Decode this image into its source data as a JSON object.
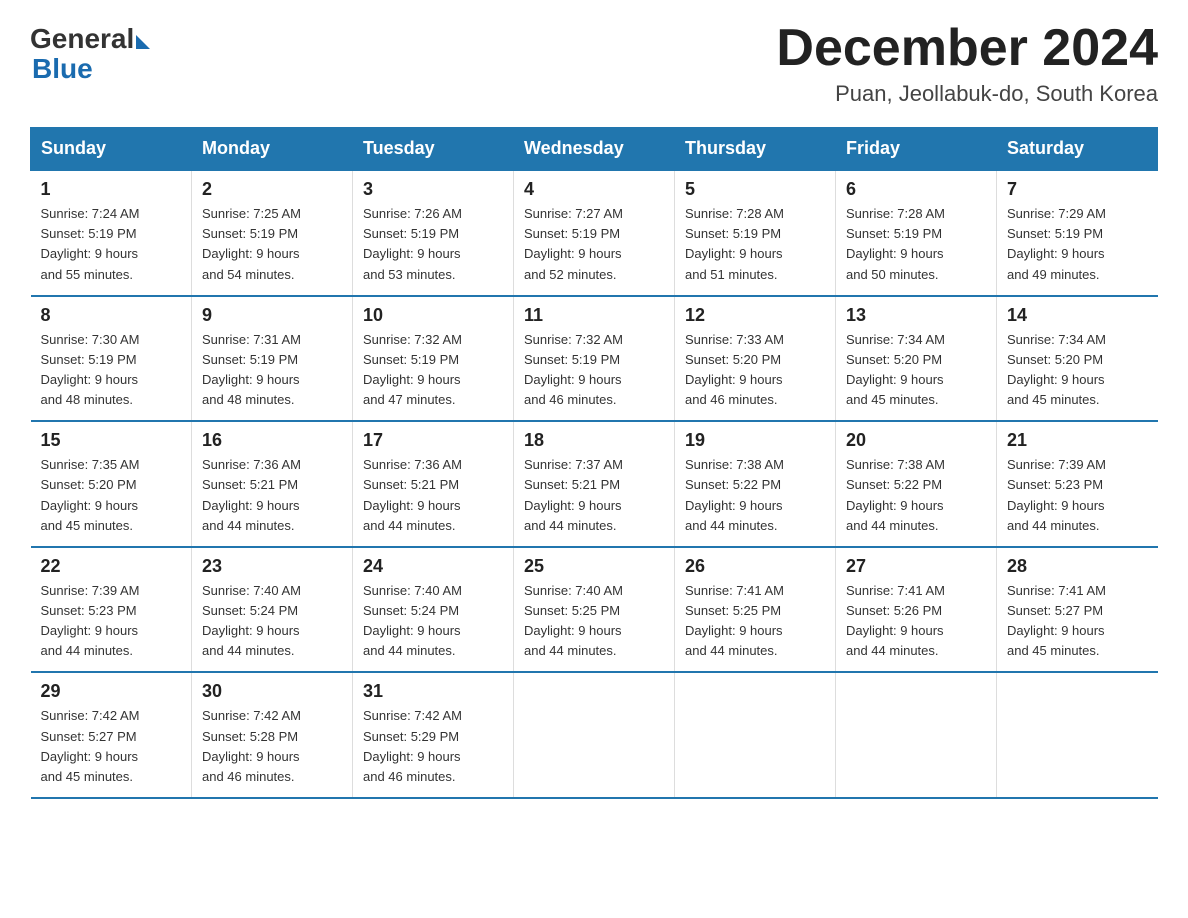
{
  "header": {
    "logo_general": "General",
    "logo_blue": "Blue",
    "month_title": "December 2024",
    "location": "Puan, Jeollabuk-do, South Korea"
  },
  "days_of_week": [
    "Sunday",
    "Monday",
    "Tuesday",
    "Wednesday",
    "Thursday",
    "Friday",
    "Saturday"
  ],
  "weeks": [
    [
      {
        "day": "1",
        "sunrise": "7:24 AM",
        "sunset": "5:19 PM",
        "daylight": "9 hours and 55 minutes."
      },
      {
        "day": "2",
        "sunrise": "7:25 AM",
        "sunset": "5:19 PM",
        "daylight": "9 hours and 54 minutes."
      },
      {
        "day": "3",
        "sunrise": "7:26 AM",
        "sunset": "5:19 PM",
        "daylight": "9 hours and 53 minutes."
      },
      {
        "day": "4",
        "sunrise": "7:27 AM",
        "sunset": "5:19 PM",
        "daylight": "9 hours and 52 minutes."
      },
      {
        "day": "5",
        "sunrise": "7:28 AM",
        "sunset": "5:19 PM",
        "daylight": "9 hours and 51 minutes."
      },
      {
        "day": "6",
        "sunrise": "7:28 AM",
        "sunset": "5:19 PM",
        "daylight": "9 hours and 50 minutes."
      },
      {
        "day": "7",
        "sunrise": "7:29 AM",
        "sunset": "5:19 PM",
        "daylight": "9 hours and 49 minutes."
      }
    ],
    [
      {
        "day": "8",
        "sunrise": "7:30 AM",
        "sunset": "5:19 PM",
        "daylight": "9 hours and 48 minutes."
      },
      {
        "day": "9",
        "sunrise": "7:31 AM",
        "sunset": "5:19 PM",
        "daylight": "9 hours and 48 minutes."
      },
      {
        "day": "10",
        "sunrise": "7:32 AM",
        "sunset": "5:19 PM",
        "daylight": "9 hours and 47 minutes."
      },
      {
        "day": "11",
        "sunrise": "7:32 AM",
        "sunset": "5:19 PM",
        "daylight": "9 hours and 46 minutes."
      },
      {
        "day": "12",
        "sunrise": "7:33 AM",
        "sunset": "5:20 PM",
        "daylight": "9 hours and 46 minutes."
      },
      {
        "day": "13",
        "sunrise": "7:34 AM",
        "sunset": "5:20 PM",
        "daylight": "9 hours and 45 minutes."
      },
      {
        "day": "14",
        "sunrise": "7:34 AM",
        "sunset": "5:20 PM",
        "daylight": "9 hours and 45 minutes."
      }
    ],
    [
      {
        "day": "15",
        "sunrise": "7:35 AM",
        "sunset": "5:20 PM",
        "daylight": "9 hours and 45 minutes."
      },
      {
        "day": "16",
        "sunrise": "7:36 AM",
        "sunset": "5:21 PM",
        "daylight": "9 hours and 44 minutes."
      },
      {
        "day": "17",
        "sunrise": "7:36 AM",
        "sunset": "5:21 PM",
        "daylight": "9 hours and 44 minutes."
      },
      {
        "day": "18",
        "sunrise": "7:37 AM",
        "sunset": "5:21 PM",
        "daylight": "9 hours and 44 minutes."
      },
      {
        "day": "19",
        "sunrise": "7:38 AM",
        "sunset": "5:22 PM",
        "daylight": "9 hours and 44 minutes."
      },
      {
        "day": "20",
        "sunrise": "7:38 AM",
        "sunset": "5:22 PM",
        "daylight": "9 hours and 44 minutes."
      },
      {
        "day": "21",
        "sunrise": "7:39 AM",
        "sunset": "5:23 PM",
        "daylight": "9 hours and 44 minutes."
      }
    ],
    [
      {
        "day": "22",
        "sunrise": "7:39 AM",
        "sunset": "5:23 PM",
        "daylight": "9 hours and 44 minutes."
      },
      {
        "day": "23",
        "sunrise": "7:40 AM",
        "sunset": "5:24 PM",
        "daylight": "9 hours and 44 minutes."
      },
      {
        "day": "24",
        "sunrise": "7:40 AM",
        "sunset": "5:24 PM",
        "daylight": "9 hours and 44 minutes."
      },
      {
        "day": "25",
        "sunrise": "7:40 AM",
        "sunset": "5:25 PM",
        "daylight": "9 hours and 44 minutes."
      },
      {
        "day": "26",
        "sunrise": "7:41 AM",
        "sunset": "5:25 PM",
        "daylight": "9 hours and 44 minutes."
      },
      {
        "day": "27",
        "sunrise": "7:41 AM",
        "sunset": "5:26 PM",
        "daylight": "9 hours and 44 minutes."
      },
      {
        "day": "28",
        "sunrise": "7:41 AM",
        "sunset": "5:27 PM",
        "daylight": "9 hours and 45 minutes."
      }
    ],
    [
      {
        "day": "29",
        "sunrise": "7:42 AM",
        "sunset": "5:27 PM",
        "daylight": "9 hours and 45 minutes."
      },
      {
        "day": "30",
        "sunrise": "7:42 AM",
        "sunset": "5:28 PM",
        "daylight": "9 hours and 46 minutes."
      },
      {
        "day": "31",
        "sunrise": "7:42 AM",
        "sunset": "5:29 PM",
        "daylight": "9 hours and 46 minutes."
      },
      null,
      null,
      null,
      null
    ]
  ]
}
